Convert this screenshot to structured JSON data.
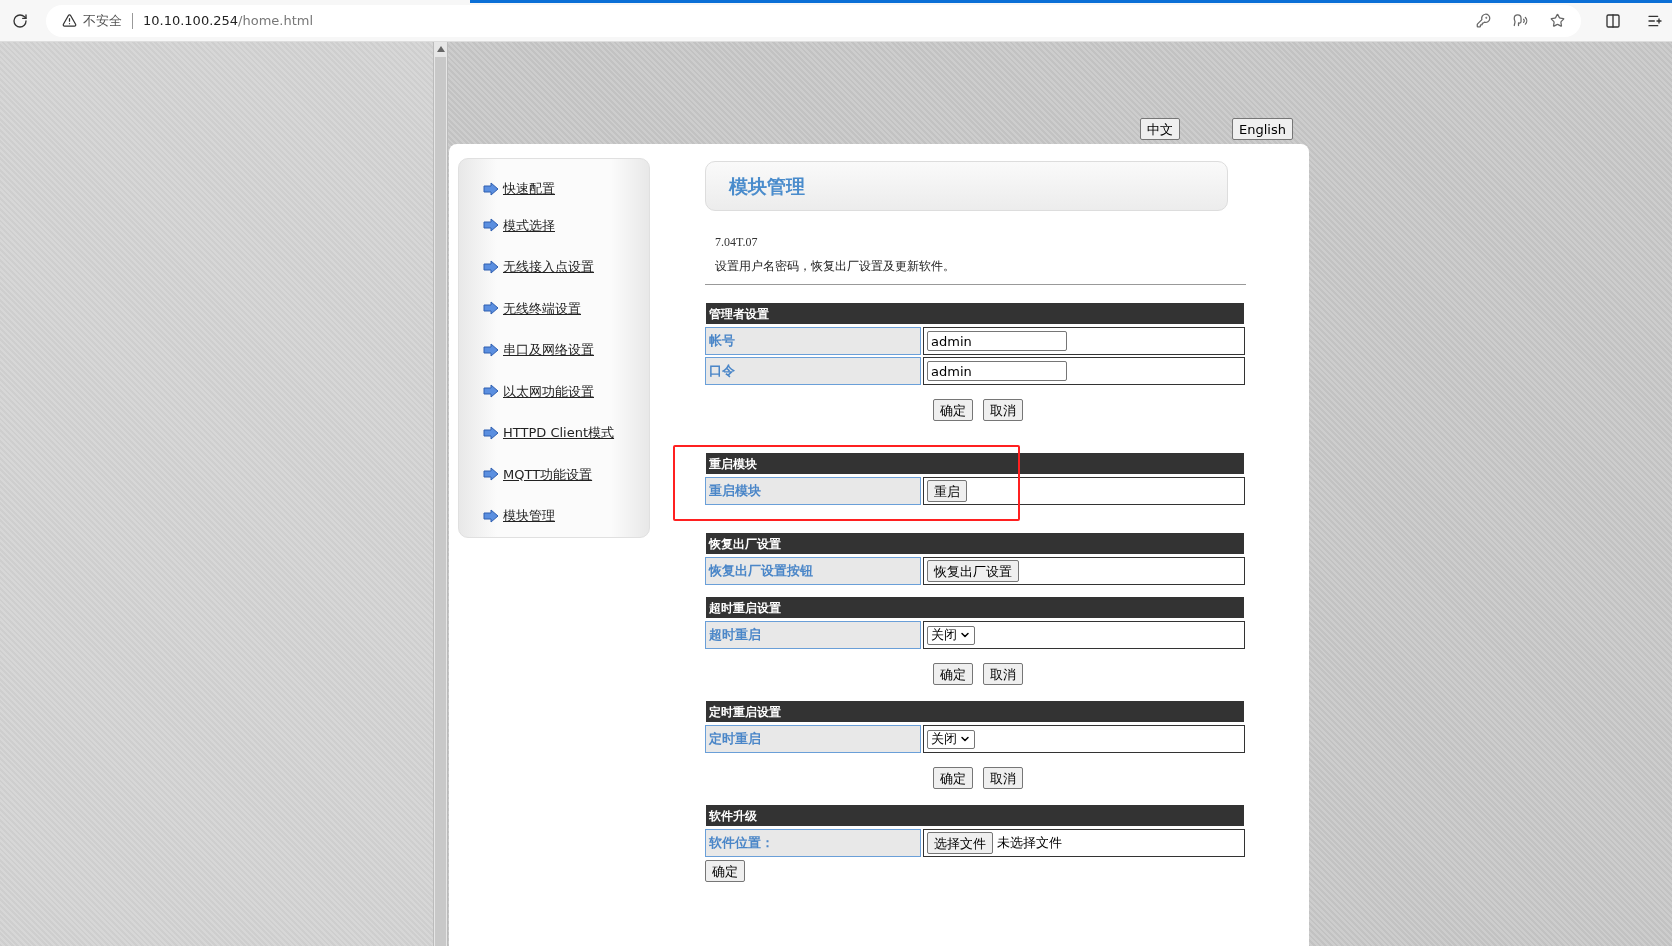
{
  "browser": {
    "security_label": "不安全",
    "url_host": "10.10.100.254",
    "url_path": "/home.html"
  },
  "language_buttons": [
    "中文",
    "English"
  ],
  "sidebar": {
    "items": [
      {
        "label": "快速配置"
      },
      {
        "label": "模式选择"
      },
      {
        "label": "无线接入点设置"
      },
      {
        "label": "无线终端设置"
      },
      {
        "label": "串口及网络设置"
      },
      {
        "label": "以太网功能设置"
      },
      {
        "label": "HTTPD Client模式"
      },
      {
        "label": "MQTT功能设置"
      },
      {
        "label": "模块管理"
      }
    ]
  },
  "page_title": "模块管理",
  "version": "7.04T.07",
  "description": "设置用户名密码，恢复出厂设置及更新软件。",
  "sections": [
    {
      "title": "管理者设置",
      "highlighted": false,
      "rows": [
        {
          "label": "帐号",
          "kind": "text",
          "value": "admin"
        },
        {
          "label": "口令",
          "kind": "text",
          "value": "admin"
        }
      ],
      "buttons": [
        "确定",
        "取消"
      ],
      "buttons_centered": true
    },
    {
      "title": "重启模块",
      "highlighted": true,
      "rows": [
        {
          "label": "重启模块",
          "kind": "button",
          "value": "重启"
        }
      ]
    },
    {
      "title": "恢复出厂设置",
      "highlighted": false,
      "rows": [
        {
          "label": "恢复出厂设置按钮",
          "kind": "button",
          "value": "恢复出厂设置"
        }
      ]
    },
    {
      "title": "超时重启设置",
      "highlighted": false,
      "rows": [
        {
          "label": "超时重启",
          "kind": "select",
          "value": "关闭"
        }
      ],
      "buttons": [
        "确定",
        "取消"
      ],
      "buttons_centered": true
    },
    {
      "title": "定时重启设置",
      "highlighted": false,
      "rows": [
        {
          "label": "定时重启",
          "kind": "select",
          "value": "关闭"
        }
      ],
      "buttons": [
        "确定",
        "取消"
      ],
      "buttons_centered": true
    },
    {
      "title": "软件升级",
      "highlighted": false,
      "rows": [
        {
          "label": "软件位置：",
          "kind": "file",
          "value": "选择文件",
          "status": "未选择文件"
        }
      ],
      "buttons": [
        "确定"
      ],
      "buttons_centered": false
    }
  ]
}
